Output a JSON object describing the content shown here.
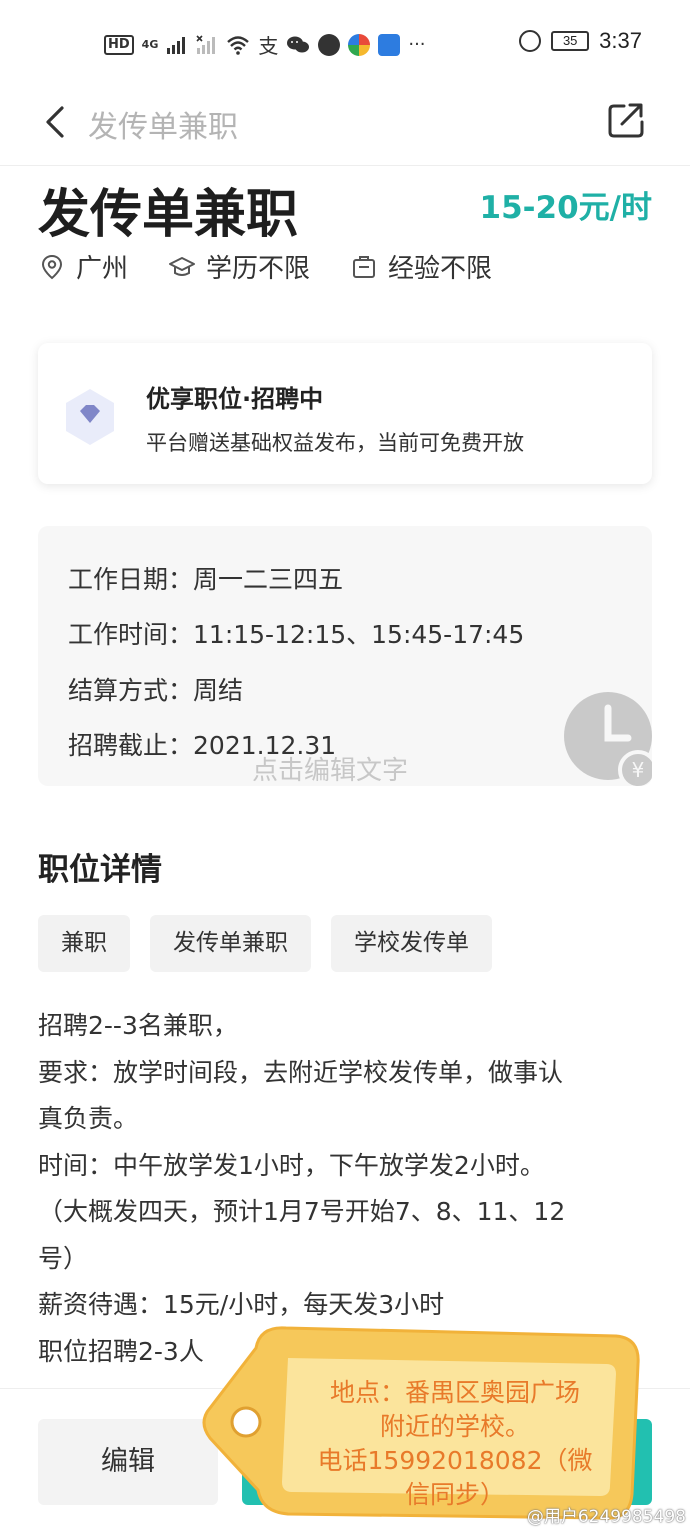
{
  "status_bar": {
    "hd": "HD",
    "net_4g": "4G",
    "battery": "35",
    "time": "3:37"
  },
  "nav": {
    "title": "发传单兼职"
  },
  "job": {
    "title": "发传单兼职",
    "salary": "15-20元/时",
    "location": "广州",
    "education": "学历不限",
    "experience": "经验不限"
  },
  "promo": {
    "title": "优享职位·招聘中",
    "desc": "平台赠送基础权益发布，当前可免费开放"
  },
  "info": {
    "rows": [
      {
        "label": "工作日期：",
        "value": "周一二三四五"
      },
      {
        "label": "工作时间：",
        "value": "11:15-12:15、15:45-17:45"
      },
      {
        "label": "结算方式：",
        "value": "周结"
      },
      {
        "label": "招聘截止：",
        "value": "2021.12.31"
      }
    ],
    "edit_hint": "点击编辑文字"
  },
  "details": {
    "title": "职位详情",
    "tags": [
      "兼职",
      "发传单兼职",
      "学校发传单"
    ],
    "lines": [
      "招聘2--3名兼职，",
      "要求：放学时间段，去附近学校发传单，做事认",
      "真负责。",
      "时间：中午放学发1小时，下午放学发2小时。",
      "（大概发四天，预计1月7号开始7、8、11、12",
      "号）",
      "薪资待遇：15元/小时，每天发3小时",
      "职位招聘2-3人"
    ]
  },
  "bottom": {
    "edit_label": "编辑"
  },
  "sticker": {
    "lines": [
      "地点：番禺区奥园广场",
      "附近的学校。",
      "电话15992018082（微",
      "信同步）"
    ]
  },
  "watermark": "@用户6249985498",
  "colors": {
    "accent": "#1fb0a6",
    "primary_button": "#22c0b0",
    "sticker_fill": "#f6c85a",
    "sticker_text": "#e87a2a"
  }
}
